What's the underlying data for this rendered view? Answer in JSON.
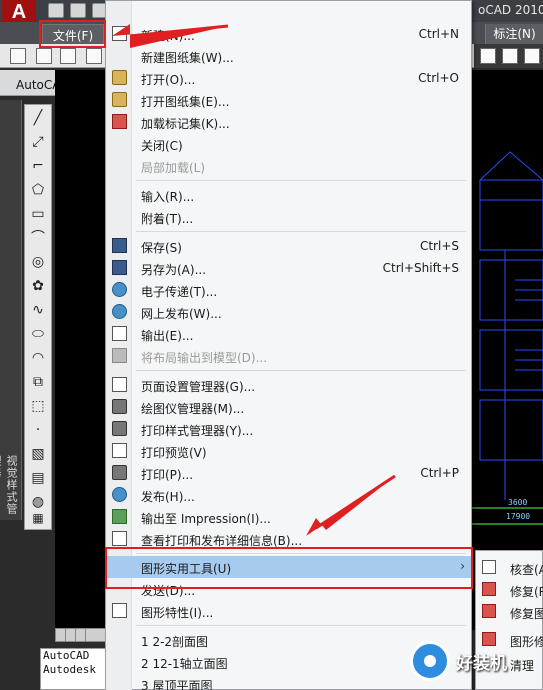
{
  "title_bar": {
    "app_title": "oCAD 2010"
  },
  "menubar": {
    "file_menu": "文件(F)",
    "annotate_menu": "标注(N)"
  },
  "workspace": {
    "name": "AutoCAD 经典"
  },
  "side_palette": {
    "title": "视觉样式管理器"
  },
  "canvas": {
    "dim_1": "3600",
    "dim_2": "17900"
  },
  "command_line": {
    "line1": "AutoCAD",
    "line2": "Autodesk"
  },
  "file_menu": {
    "items": [
      {
        "label": "新建(N)...",
        "shortcut": "Ctrl+N",
        "icon": "new-doc-icon",
        "enabled": true
      },
      {
        "label": "新建图纸集(W)...",
        "shortcut": "",
        "icon": "",
        "enabled": true
      },
      {
        "label": "打开(O)...",
        "shortcut": "Ctrl+O",
        "icon": "open-folder-icon",
        "enabled": true
      },
      {
        "label": "打开图纸集(E)...",
        "shortcut": "",
        "icon": "open-sheetset-icon",
        "enabled": true
      },
      {
        "label": "加载标记集(K)...",
        "shortcut": "",
        "icon": "markup-icon",
        "enabled": true
      },
      {
        "label": "关闭(C)",
        "shortcut": "",
        "icon": "",
        "enabled": true
      },
      {
        "label": "局部加载(L)",
        "shortcut": "",
        "icon": "",
        "enabled": false
      },
      {
        "label": "输入(R)...",
        "shortcut": "",
        "icon": "",
        "enabled": true
      },
      {
        "label": "附着(T)...",
        "shortcut": "",
        "icon": "",
        "enabled": true
      },
      {
        "label": "保存(S)",
        "shortcut": "Ctrl+S",
        "icon": "save-icon",
        "enabled": true
      },
      {
        "label": "另存为(A)...",
        "shortcut": "Ctrl+Shift+S",
        "icon": "save-as-icon",
        "enabled": true
      },
      {
        "label": "电子传递(T)...",
        "shortcut": "",
        "icon": "etransmit-icon",
        "enabled": true
      },
      {
        "label": "网上发布(W)...",
        "shortcut": "",
        "icon": "publish-web-icon",
        "enabled": true
      },
      {
        "label": "输出(E)...",
        "shortcut": "",
        "icon": "export-icon",
        "enabled": true
      },
      {
        "label": "将布局输出到模型(D)...",
        "shortcut": "",
        "icon": "layout-export-icon",
        "enabled": false
      },
      {
        "label": "页面设置管理器(G)...",
        "shortcut": "",
        "icon": "page-setup-icon",
        "enabled": true
      },
      {
        "label": "绘图仪管理器(M)...",
        "shortcut": "",
        "icon": "plotter-icon",
        "enabled": true
      },
      {
        "label": "打印样式管理器(Y)...",
        "shortcut": "",
        "icon": "plot-style-icon",
        "enabled": true
      },
      {
        "label": "打印预览(V)",
        "shortcut": "",
        "icon": "plot-preview-icon",
        "enabled": true
      },
      {
        "label": "打印(P)...",
        "shortcut": "Ctrl+P",
        "icon": "print-icon",
        "enabled": true
      },
      {
        "label": "发布(H)...",
        "shortcut": "",
        "icon": "publish-icon",
        "enabled": true
      },
      {
        "label": "输出至 Impression(I)...",
        "shortcut": "",
        "icon": "impression-icon",
        "enabled": true
      },
      {
        "label": "查看打印和发布详细信息(B)...",
        "shortcut": "",
        "icon": "plot-details-icon",
        "enabled": true
      },
      {
        "label": "图形实用工具(U)",
        "shortcut": "",
        "icon": "",
        "enabled": true,
        "highlighted": true,
        "submenu": true
      },
      {
        "label": "发送(D)...",
        "shortcut": "",
        "icon": "",
        "enabled": true
      },
      {
        "label": "图形特性(I)...",
        "shortcut": "",
        "icon": "drawing-props-icon",
        "enabled": true
      },
      {
        "label": "1 2-2剖面图",
        "shortcut": "",
        "icon": "",
        "enabled": true
      },
      {
        "label": "2 12-1轴立面图",
        "shortcut": "",
        "icon": "",
        "enabled": true
      },
      {
        "label": "3 屋顶平面图",
        "shortcut": "",
        "icon": "",
        "enabled": true
      }
    ]
  },
  "utilities_submenu": {
    "items": [
      {
        "label": "核查(A)"
      },
      {
        "label": "修复(R)"
      },
      {
        "label": "修复图"
      },
      {
        "label": "图形修"
      },
      {
        "label": "清理"
      }
    ]
  },
  "watermark": {
    "text": "好装机"
  },
  "colors": {
    "highlight": "#a6cbee",
    "annotation_red": "#e02020",
    "menu_bg": "#f5f6f7"
  }
}
